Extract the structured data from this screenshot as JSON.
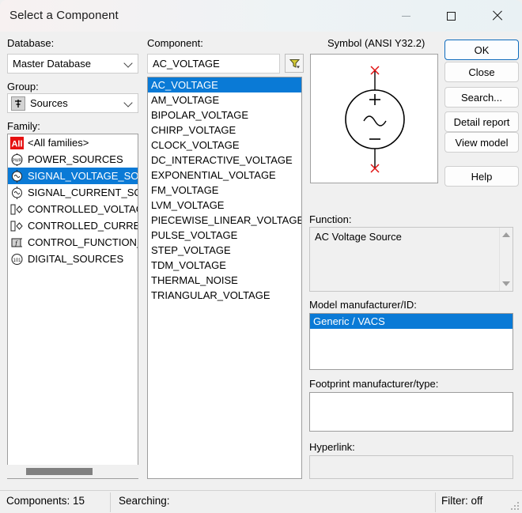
{
  "window": {
    "title": "Select a Component",
    "controls": {
      "minimize": "minimize-icon",
      "maximize": "maximize-icon",
      "close": "close-icon"
    }
  },
  "left_panel": {
    "database_label": "Database:",
    "database_value": "Master Database",
    "group_label": "Group:",
    "group_value": "Sources",
    "family_label": "Family:",
    "families": [
      {
        "label": "<All families>",
        "icon": "all-families-icon",
        "selected": false
      },
      {
        "label": "POWER_SOURCES",
        "icon": "power-sources-icon",
        "selected": false
      },
      {
        "label": "SIGNAL_VOLTAGE_SOURCES",
        "icon": "signal-voltage-source-icon",
        "selected": true
      },
      {
        "label": "SIGNAL_CURRENT_SOURCES",
        "icon": "signal-current-source-icon",
        "selected": false
      },
      {
        "label": "CONTROLLED_VOLTAGE_SOURCES",
        "icon": "controlled-voltage-icon",
        "selected": false
      },
      {
        "label": "CONTROLLED_CURRENT_SOURCES",
        "icon": "controlled-current-icon",
        "selected": false
      },
      {
        "label": "CONTROL_FUNCTION_BLOCKS",
        "icon": "control-function-icon",
        "selected": false
      },
      {
        "label": "DIGITAL_SOURCES",
        "icon": "digital-sources-icon",
        "selected": false
      }
    ]
  },
  "component_panel": {
    "label": "Component:",
    "search_value": "AC_VOLTAGE",
    "filter_icon": "filter-funnel-icon",
    "items": [
      {
        "label": "AC_VOLTAGE",
        "selected": true
      },
      {
        "label": "AM_VOLTAGE",
        "selected": false
      },
      {
        "label": "BIPOLAR_VOLTAGE",
        "selected": false
      },
      {
        "label": "CHIRP_VOLTAGE",
        "selected": false
      },
      {
        "label": "CLOCK_VOLTAGE",
        "selected": false
      },
      {
        "label": "DC_INTERACTIVE_VOLTAGE",
        "selected": false
      },
      {
        "label": "EXPONENTIAL_VOLTAGE",
        "selected": false
      },
      {
        "label": "FM_VOLTAGE",
        "selected": false
      },
      {
        "label": "LVM_VOLTAGE",
        "selected": false
      },
      {
        "label": "PIECEWISE_LINEAR_VOLTAGE",
        "selected": false
      },
      {
        "label": "PULSE_VOLTAGE",
        "selected": false
      },
      {
        "label": "STEP_VOLTAGE",
        "selected": false
      },
      {
        "label": "TDM_VOLTAGE",
        "selected": false
      },
      {
        "label": "THERMAL_NOISE",
        "selected": false
      },
      {
        "label": "TRIANGULAR_VOLTAGE",
        "selected": false
      }
    ]
  },
  "right_panel": {
    "symbol_label": "Symbol (ANSI Y32.2)",
    "symbol_icon": "ac-voltage-source-symbol",
    "buttons": [
      {
        "label": "OK",
        "primary": true
      },
      {
        "label": "Close",
        "primary": false
      },
      {
        "label": "Search...",
        "primary": false
      },
      {
        "label": "Detail report",
        "primary": false
      },
      {
        "label": "View model",
        "primary": false
      },
      {
        "label": "Help",
        "primary": false
      }
    ],
    "function_label": "Function:",
    "function_value": "AC Voltage Source",
    "model_label": "Model manufacturer/ID:",
    "model_value": "Generic / VACS",
    "footprint_label": "Footprint manufacturer/type:",
    "footprint_value": "",
    "hyperlink_label": "Hyperlink:",
    "hyperlink_value": ""
  },
  "statusbar": {
    "components": "Components: 15",
    "searching": "Searching:",
    "filter": "Filter: off"
  },
  "colors": {
    "selection_blue": "#0a7ad6",
    "accent_border": "#0d6bbd",
    "window_bg": "#f0f0f0",
    "terminal_red": "#e01010"
  }
}
